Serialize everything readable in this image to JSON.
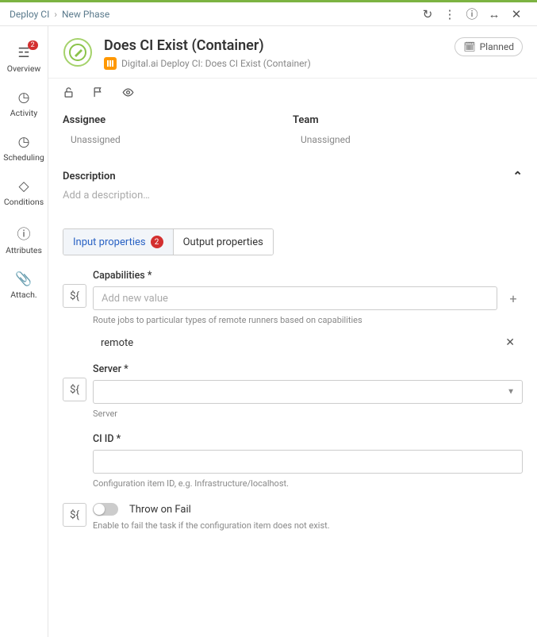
{
  "breadcrumb": {
    "root": "Deploy CI",
    "current": "New Phase"
  },
  "header": {
    "title": "Does CI Exist (Container)",
    "subtitle": "Digital.ai Deploy CI: Does CI Exist (Container)",
    "status": "Planned"
  },
  "sidebar": {
    "items": [
      {
        "label": "Overview",
        "icon": "list",
        "badge": "2"
      },
      {
        "label": "Activity",
        "icon": "clock"
      },
      {
        "label": "Scheduling",
        "icon": "clock2"
      },
      {
        "label": "Conditions",
        "icon": "diamond"
      },
      {
        "label": "Attributes",
        "icon": "info"
      },
      {
        "label": "Attach.",
        "icon": "clip"
      }
    ]
  },
  "assignment": {
    "assignee_label": "Assignee",
    "assignee_value": "Unassigned",
    "team_label": "Team",
    "team_value": "Unassigned"
  },
  "description": {
    "label": "Description",
    "placeholder": "Add a description…"
  },
  "tabs": {
    "input": {
      "label": "Input properties",
      "count": "2"
    },
    "output": {
      "label": "Output properties"
    }
  },
  "form": {
    "capabilities": {
      "label": "Capabilities *",
      "placeholder": "Add new value",
      "help": "Route jobs to particular types of remote runners based on capabilities",
      "values": [
        "remote"
      ]
    },
    "server": {
      "label": "Server *",
      "help": "Server"
    },
    "ciid": {
      "label": "CI ID *",
      "help": "Configuration item ID, e.g. Infrastructure/localhost."
    },
    "throw": {
      "label": "Throw on Fail",
      "help": "Enable to fail the task if the configuration item does not exist."
    }
  }
}
